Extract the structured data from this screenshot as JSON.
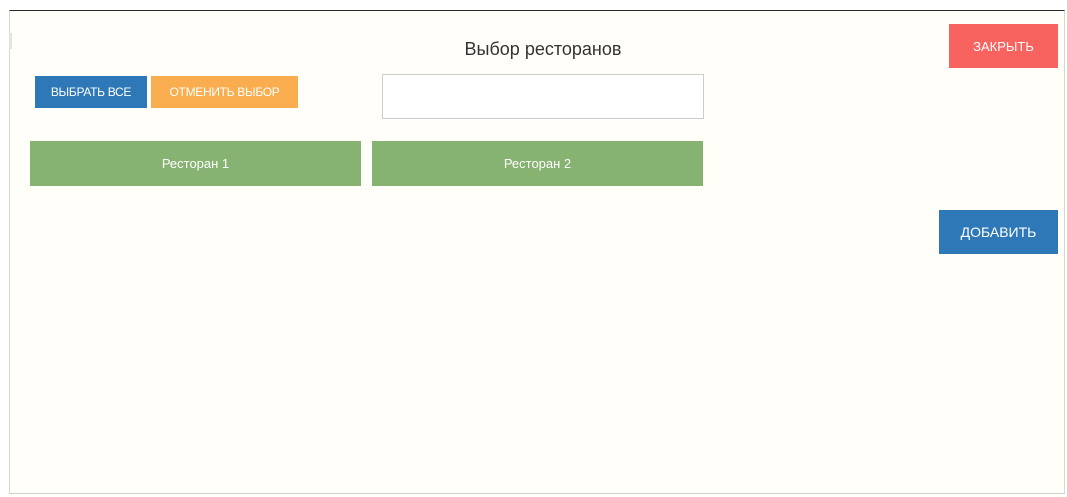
{
  "dialog": {
    "title": "Выбор ресторанов",
    "close_label": "ЗАКРЫТЬ",
    "add_label": "ДОБАВИТЬ"
  },
  "toolbar": {
    "select_all_label": "ВЫБРАТЬ ВСЕ",
    "deselect_label": "ОТМЕНИТЬ ВЫБОР"
  },
  "search": {
    "value": "",
    "placeholder": ""
  },
  "restaurants": [
    {
      "label": "Ресторан 1"
    },
    {
      "label": "Ресторан 2"
    }
  ],
  "colors": {
    "primary": "#2e78b8",
    "warning": "#f9ad4e",
    "danger": "#f86360",
    "item": "#86b272",
    "background": "#fffef8"
  }
}
